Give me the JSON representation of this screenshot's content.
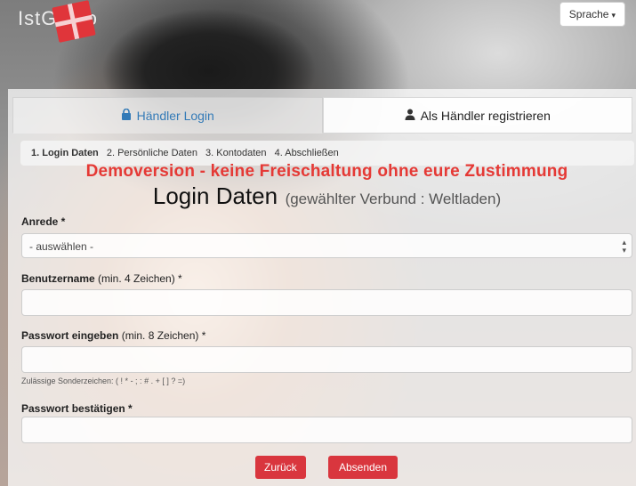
{
  "header": {
    "logo_text": "IstGoldo",
    "language_button": "Sprache",
    "language_caret": "▾"
  },
  "tabs": [
    {
      "label": "Händler Login",
      "icon": "lock-icon",
      "active": true
    },
    {
      "label": "Als Händler registrieren",
      "icon": "user-icon",
      "active": false
    }
  ],
  "steps": {
    "items": [
      "1. Login Daten",
      "2. Persönliche Daten",
      "3. Kontodaten",
      "4. Abschließen"
    ],
    "current_index": 0
  },
  "notice": "Demoversion - keine Freischaltung ohne eure Zustimmung",
  "heading": {
    "title": "Login Daten",
    "subtitle": "(gewählter Verbund : Weltladen)"
  },
  "form": {
    "anrede": {
      "label": "Anrede *",
      "value": "- auswählen -"
    },
    "benutzername": {
      "label_bold": "Benutzername",
      "label_rest": " (min. 4 Zeichen) *",
      "value": ""
    },
    "passwort": {
      "label_bold": "Passwort eingeben",
      "label_rest": " (min. 8 Zeichen) *",
      "value": "",
      "hint": "Zulässige Sonderzeichen: ( ! * - ; : # . + [ ] ? =)"
    },
    "passwort_confirm": {
      "label": "Passwort bestätigen *",
      "value": ""
    }
  },
  "buttons": {
    "back": "Zurück",
    "submit": "Absenden"
  },
  "colors": {
    "accent": "#d9363e",
    "notice": "#e53935",
    "link": "#337ab7"
  }
}
